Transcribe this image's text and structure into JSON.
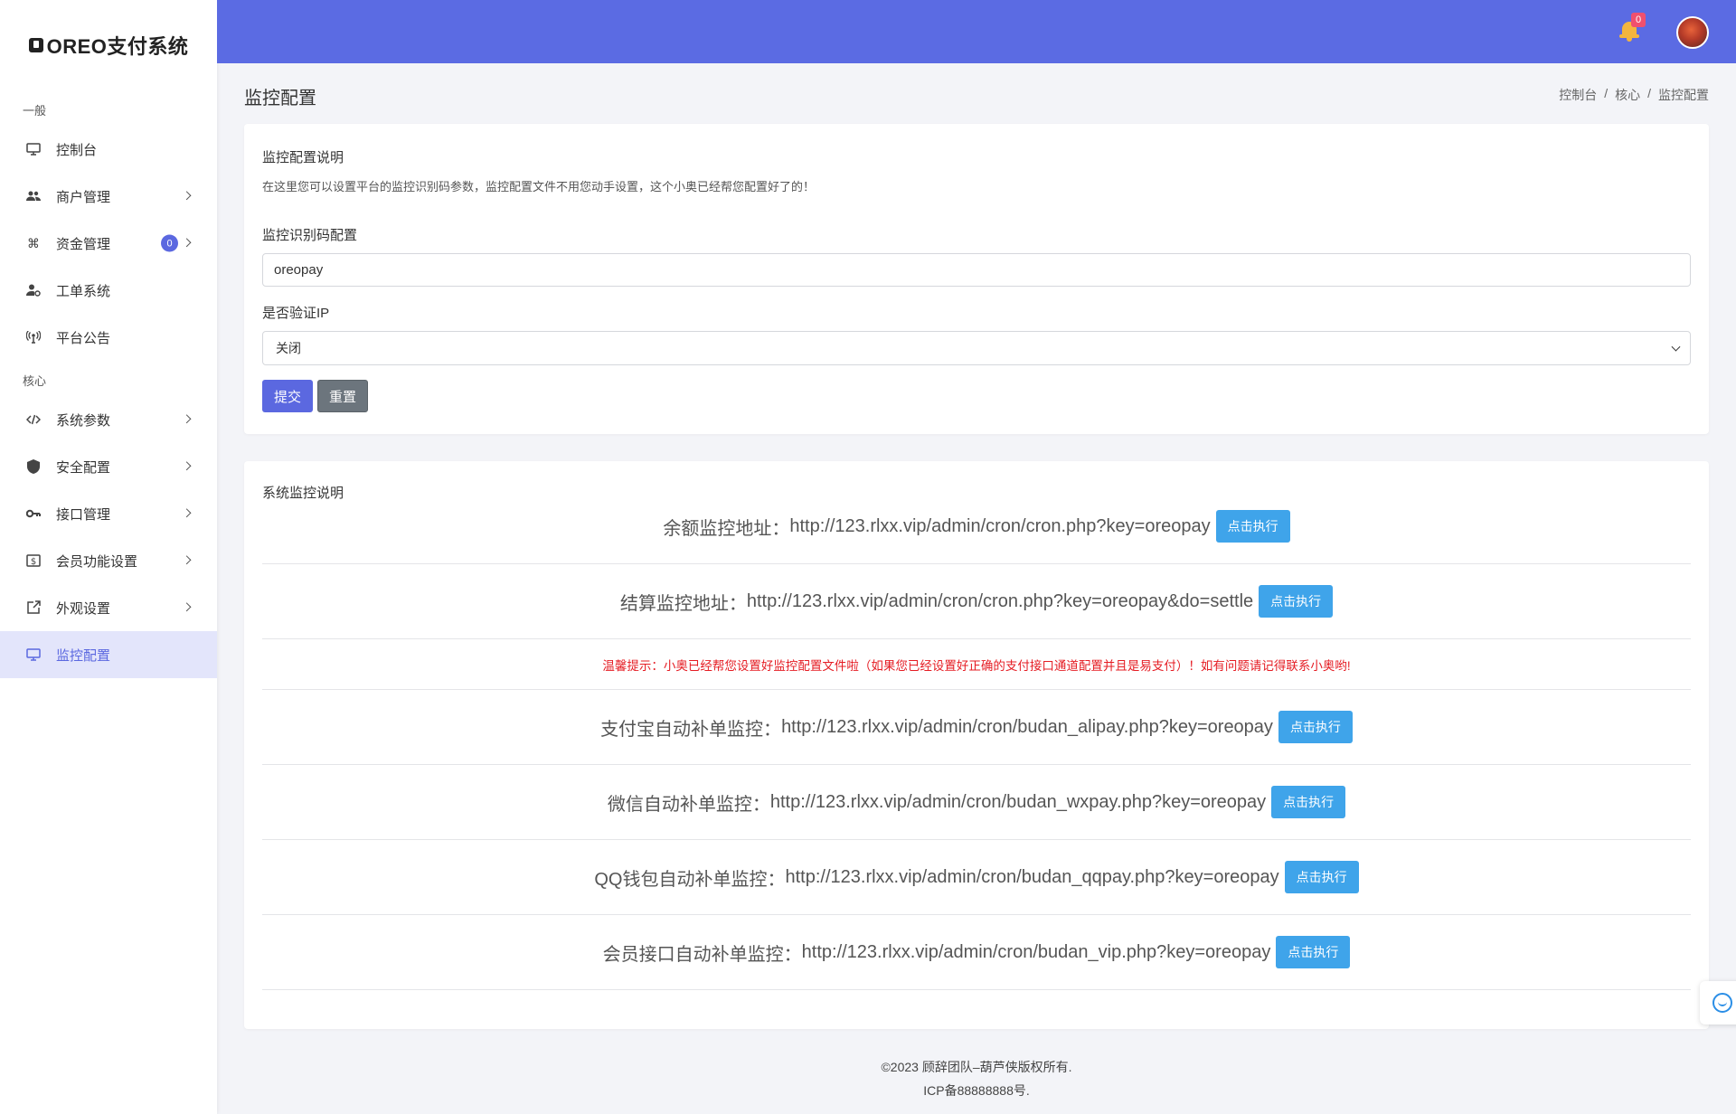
{
  "brand": {
    "title": "OREO支付系统"
  },
  "sidebar": {
    "section_general": "一般",
    "section_core": "核心",
    "items": [
      {
        "label": "控制台",
        "icon": "monitor-icon"
      },
      {
        "label": "商户管理",
        "icon": "users-icon"
      },
      {
        "label": "资金管理",
        "icon": "command-icon",
        "count": "0"
      },
      {
        "label": "工单系统",
        "icon": "user-settings-icon"
      },
      {
        "label": "平台公告",
        "icon": "broadcast-icon"
      },
      {
        "label": "系统参数",
        "icon": "code-icon"
      },
      {
        "label": "安全配置",
        "icon": "shield-icon"
      },
      {
        "label": "接口管理",
        "icon": "key-icon"
      },
      {
        "label": "会员功能设置",
        "icon": "dollar-box-icon"
      },
      {
        "label": "外观设置",
        "icon": "external-icon"
      },
      {
        "label": "监控配置",
        "icon": "monitor-icon"
      }
    ]
  },
  "header": {
    "notification_count": "0"
  },
  "page": {
    "title": "监控配置",
    "breadcrumb": [
      "控制台",
      "核心",
      "监控配置"
    ],
    "breadcrumb_sep": "/"
  },
  "config_card": {
    "title": "监控配置说明",
    "subtitle": "在这里您可以设置平台的监控识别码参数，监控配置文件不用您动手设置，这个小奥已经帮您配置好了的！",
    "key_label": "监控识别码配置",
    "key_value": "oreopay",
    "verify_ip_label": "是否验证IP",
    "verify_ip_value": "关闭",
    "submit_label": "提交",
    "reset_label": "重置"
  },
  "monitor_card": {
    "title": "系统监控说明",
    "exec_label": "点击执行",
    "warning": "温馨提示：小奥已经帮您设置好监控配置文件啦（如果您已经设置好正确的支付接口通道配置并且是易支付）！如有问题请记得联系小奥哟!",
    "rows": [
      {
        "label": "余额监控地址：",
        "url": "http://123.rlxx.vip/admin/cron/cron.php?key=oreopay"
      },
      {
        "label": "结算监控地址：",
        "url": "http://123.rlxx.vip/admin/cron/cron.php?key=oreopay&do=settle"
      },
      {
        "label": "支付宝自动补单监控：",
        "url": "http://123.rlxx.vip/admin/cron/budan_alipay.php?key=oreopay"
      },
      {
        "label": "微信自动补单监控：",
        "url": "http://123.rlxx.vip/admin/cron/budan_wxpay.php?key=oreopay"
      },
      {
        "label": "QQ钱包自动补单监控：",
        "url": "http://123.rlxx.vip/admin/cron/budan_qqpay.php?key=oreopay"
      },
      {
        "label": "会员接口自动补单监控：",
        "url": "http://123.rlxx.vip/admin/cron/budan_vip.php?key=oreopay"
      }
    ]
  },
  "footer": {
    "copyright": "©2023 顾辞团队–葫芦侠版权所有.",
    "icp": "ICP备88888888号."
  },
  "colors": {
    "accent": "#5b6be3",
    "exec_button": "#3fa4ea",
    "warning": "#e51c23"
  }
}
